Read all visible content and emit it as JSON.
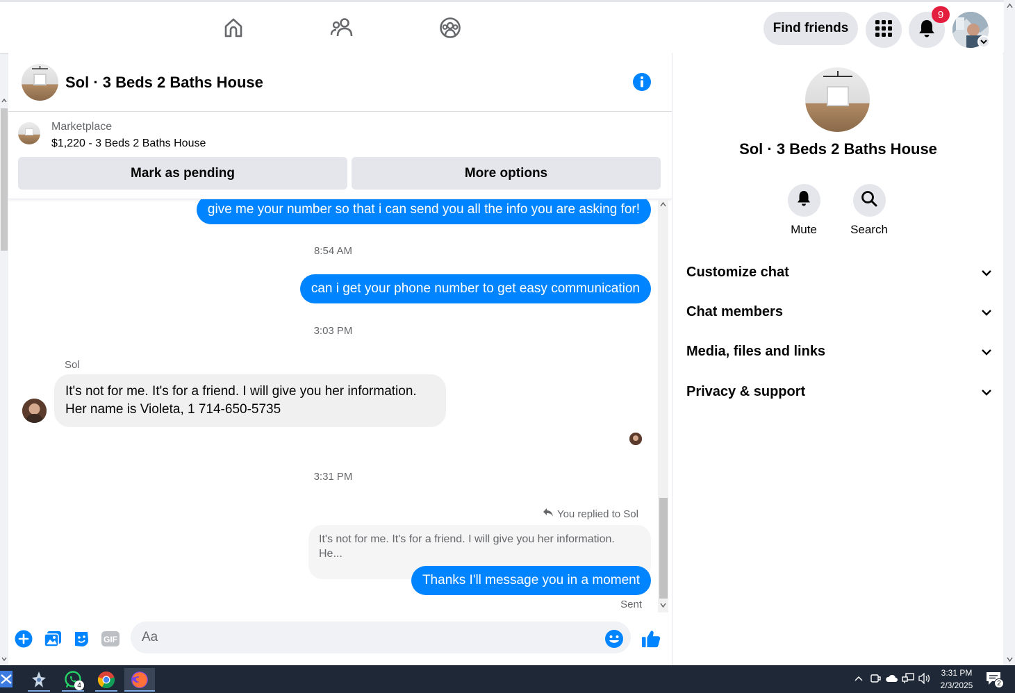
{
  "topnav": {
    "find_friends_label": "Find friends",
    "notification_count": "9",
    "icons": [
      "home-icon",
      "friends-icon",
      "groups-icon",
      "menu-grid-icon",
      "bell-icon"
    ]
  },
  "chat": {
    "title": "Sol · 3 Beds 2 Baths House",
    "marketplace_label": "Marketplace",
    "listing": "$1,220 - 3 Beds 2 Baths House",
    "mark_pending_label": "Mark as pending",
    "more_options_label": "More options",
    "messages": {
      "out_1": "give me your number so that i can send you all the info you are asking for!",
      "time_1": "8:54 AM",
      "out_2": "can i get your phone number to get easy communication",
      "time_2": "3:03 PM",
      "sender": "Sol",
      "in_1_line1": "It's not for me. It's for a friend. I will give you her information.",
      "in_1_line2": "Her name is Violeta, 1 714-650-5735",
      "time_3": "3:31 PM",
      "reply_label": "You replied to Sol",
      "reply_quote": "It's not for me. It's for a friend. I will give you her information. He...",
      "out_3": "Thanks I'll message you in a moment",
      "status": "Sent"
    },
    "composer": {
      "placeholder": "Aa"
    }
  },
  "right_panel": {
    "title": "Sol · 3 Beds 2 Baths House",
    "mute_label": "Mute",
    "search_label": "Search",
    "sections": [
      "Customize chat",
      "Chat members",
      "Media, files and links",
      "Privacy & support"
    ]
  },
  "taskbar": {
    "whatsapp_count": "4",
    "time": "3:31 PM",
    "date": "2/3/2025",
    "notifications_count": "2"
  },
  "colors": {
    "accent": "#0084ff",
    "badge": "#e41e3f",
    "button_gray": "#e4e6eb"
  }
}
